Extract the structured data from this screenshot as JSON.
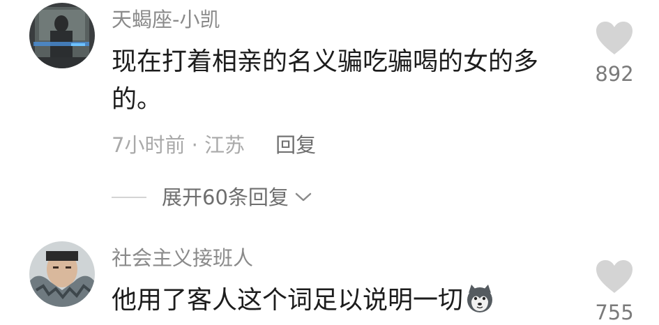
{
  "comments": [
    {
      "username": "天蝎座-小凯",
      "text": "现在打着相亲的名义骗吃骗喝的女的多的。",
      "time_location": "7小时前 · 江苏",
      "reply_label": "回复",
      "likes": "892"
    },
    {
      "username": "社会主义接班人",
      "text": "他用了客人这个词足以说明一切",
      "emoji_icon": "husky-dog-icon",
      "likes": "755"
    }
  ],
  "expand_replies": "展开60条回复",
  "colors": {
    "username": "#8a8a8a",
    "text": "#1c1c1c",
    "meta": "#a9a9a9",
    "heart": "#d4d4d4",
    "count": "#7a7a7a"
  }
}
